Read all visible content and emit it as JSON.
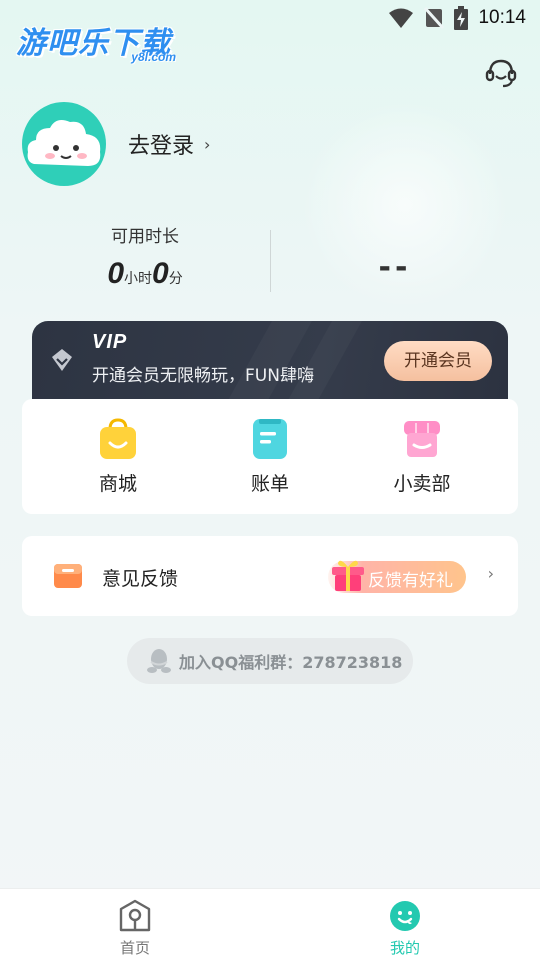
{
  "status_bar": {
    "time": "10:14"
  },
  "logo": {
    "text": "游吧乐下载",
    "sub": "y8l.com"
  },
  "profile": {
    "login_label": "去登录",
    "chevron": "›"
  },
  "stats": {
    "duration_label": "可用时长",
    "hours_value": "0",
    "hours_unit": "小时",
    "minutes_value": "0",
    "minutes_unit": "分",
    "right_value": "--"
  },
  "vip": {
    "title": "VIP",
    "description": "开通会员无限畅玩，FUN肆嗨",
    "button_label": "开通会员"
  },
  "menu": {
    "items": [
      {
        "label": "商城",
        "icon": "shopping-bag-icon"
      },
      {
        "label": "账单",
        "icon": "bill-icon"
      },
      {
        "label": "小卖部",
        "icon": "store-icon"
      }
    ]
  },
  "feedback": {
    "label": "意见反馈",
    "badge": "反馈有好礼",
    "icon": "feedback-icon",
    "chevron": "›"
  },
  "qq_group": {
    "text": "加入QQ福利群：278723818"
  },
  "bottom_nav": {
    "home_label": "首页",
    "mine_label": "我的"
  },
  "colors": {
    "accent": "#23c9b0",
    "vip_bg": "#2d3442",
    "vip_button": "#f5c09f"
  }
}
